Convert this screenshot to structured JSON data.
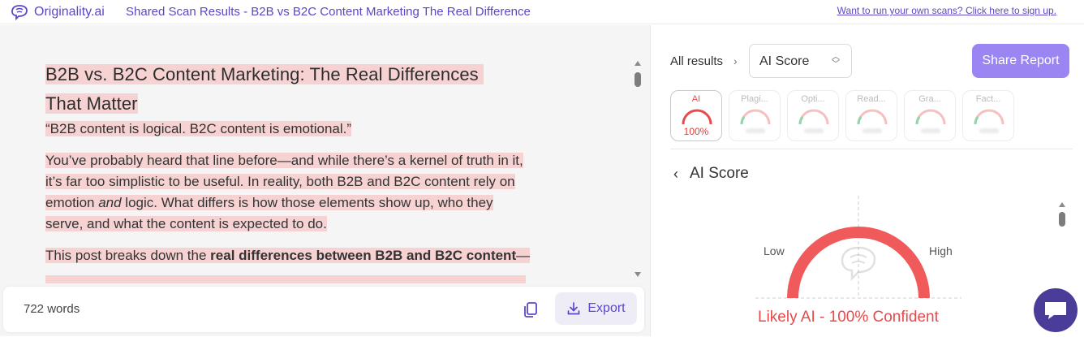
{
  "header": {
    "logo_text": "Originality.ai",
    "title": "Shared Scan Results - B2B vs B2C Content Marketing The Real Difference",
    "signup_link": "Want to run your own scans? Click here to sign up."
  },
  "document": {
    "title_line1": "B2B vs. B2C Content Marketing: The Real Differences",
    "title_line2": "That Matter",
    "quote": "“B2B content is logical. B2C content is emotional.”",
    "p2_line1": "You’ve probably heard that line before—and while there’s a kernel of truth in it,",
    "p2_line2": "it’s far too simplistic to be useful. In reality, both B2B and B2C content rely on",
    "p2_line3_pre": "emotion ",
    "p2_line3_em": "and",
    "p2_line3_post": " logic. What differs is how those elements show up, who they",
    "p2_line4": "serve, and what the content is expected to do.",
    "p3_pre": "This post breaks down the ",
    "p3_bold": "real differences between B2B and B2C content",
    "p3_post": "—"
  },
  "footer": {
    "word_count": "722 words",
    "export_label": "Export"
  },
  "results": {
    "breadcrumb": "All results",
    "select_value": "AI Score",
    "share_label": "Share Report",
    "tabs": [
      {
        "label": "AI",
        "value": "100%",
        "color": "#e74c4c"
      },
      {
        "label": "Plagi...",
        "value": "",
        "color": "#f4b6b6"
      },
      {
        "label": "Opti...",
        "value": "",
        "color": "#f4b6b6"
      },
      {
        "label": "Read...",
        "value": "",
        "color": "#f4b6b6"
      },
      {
        "label": "Gra...",
        "value": "",
        "color": "#f4b6b6"
      },
      {
        "label": "Fact...",
        "value": "",
        "color": "#f4b6b6"
      }
    ],
    "section_title": "AI Score",
    "gauge": {
      "low_label": "Low",
      "high_label": "High",
      "level": 1.0,
      "color": "#f05a5a"
    },
    "verdict": "Likely AI - 100% Confident"
  },
  "colors": {
    "brand": "#5b47c9",
    "highlight": "#f6d2d2",
    "share_button": "#9b85f2"
  }
}
